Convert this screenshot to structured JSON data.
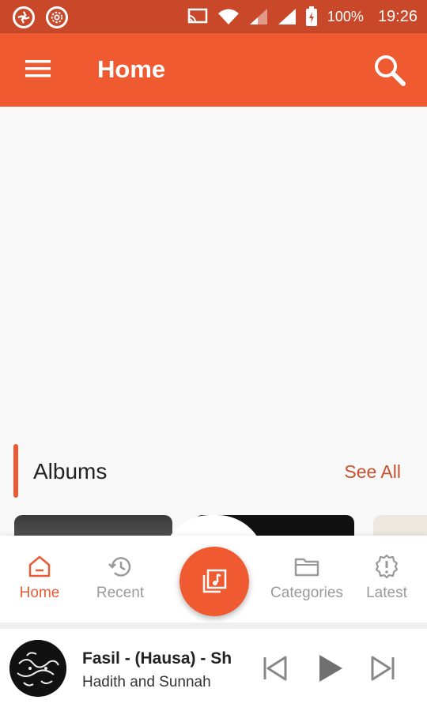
{
  "status_bar": {
    "battery_percent": "100%",
    "time": "19:26",
    "icons": [
      "aperture-icon",
      "flower-icon",
      "cast-icon",
      "wifi-icon",
      "signal-icon",
      "signal-icon",
      "battery-charging-icon"
    ]
  },
  "app_bar": {
    "title": "Home",
    "menu_icon": "hamburger-menu-icon",
    "search_icon": "search-icon"
  },
  "albums_section": {
    "title": "Albums",
    "see_all": "See All"
  },
  "bottom_nav": {
    "items": [
      {
        "label": "Home",
        "icon": "home-icon",
        "active": true
      },
      {
        "label": "Recent",
        "icon": "history-icon",
        "active": false
      },
      {
        "label": "Categories",
        "icon": "folder-icon",
        "active": false
      },
      {
        "label": "Latest",
        "icon": "alert-badge-icon",
        "active": false
      }
    ],
    "center_button_icon": "music-library-icon"
  },
  "player": {
    "track_title": "Fasil - (Hausa) - Sh",
    "track_subtitle": "Hadith and Sunnah",
    "controls": [
      "skip-previous-icon",
      "play-icon",
      "skip-next-icon"
    ]
  },
  "colors": {
    "status_bar": "#c9482a",
    "accent": "#f05a30",
    "active_text": "#ea5a35",
    "see_all_text": "#c8512e",
    "inactive_text": "#9a9a9a",
    "background": "#f8f8f8"
  }
}
